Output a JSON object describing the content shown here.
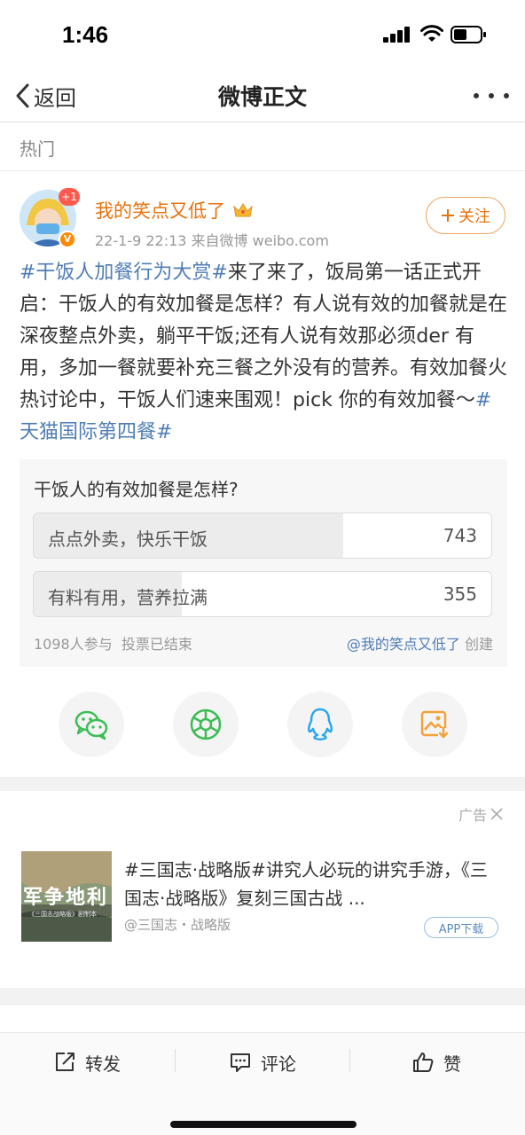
{
  "status_bar": {
    "time": "1:46"
  },
  "nav": {
    "back_label": "返回",
    "title": "微博正文"
  },
  "section": {
    "label": "热门"
  },
  "post": {
    "avatar_badge": "+1",
    "avatar_verified": "V",
    "username": "我的笑点又低了",
    "meta": "22-1-9 22:13  来自微博 weibo.com",
    "follow_label": "关注",
    "text": {
      "tag1": "#干饭人加餐行为大赏#",
      "body": "来了来了，饭局第一话正式开启：干饭人的有效加餐是怎样？有人说有效的加餐就是在深夜整点外卖，躺平干饭;还有人说有效那必须der 有用，多加一餐就要补充三餐之外没有的营养。有效加餐火热讨论中，干饭人们速来围观！pick 你的有效加餐～",
      "tag2": "#天猫国际第四餐#"
    }
  },
  "poll": {
    "question": "干饭人的有效加餐是怎样?",
    "options": [
      {
        "label": "点点外卖，快乐干饭",
        "count": "743",
        "fraction": 0.677
      },
      {
        "label": "有料有用，营养拉满",
        "count": "355",
        "fraction": 0.323
      }
    ],
    "participants": "1098人参与",
    "status": "投票已结束",
    "creator": "@我的笑点又低了",
    "created_label": "创建"
  },
  "share": {
    "icons": [
      "wechat-icon",
      "moments-icon",
      "qq-icon",
      "save-image-icon"
    ],
    "colors": {
      "wechat": "#3bbd54",
      "moments": "#3bbd54",
      "qq": "#2aa6f0",
      "save": "#f2a23a"
    }
  },
  "ad": {
    "label": "广告",
    "title": "#三国志·战略版#讲究人必玩的讲究手游，《三国志·战略版》复刻三国古战 ...",
    "source": "@三国志・战略版",
    "button": "APP下载",
    "thumb_text": "军争地利",
    "thumb_subtext": "《三国志战略版》剧制本"
  },
  "bottom_bar": {
    "repost": "转发",
    "comment": "评论",
    "like": "赞"
  },
  "colors": {
    "accent_orange": "#e8720c",
    "link_blue": "#4f7db5"
  }
}
